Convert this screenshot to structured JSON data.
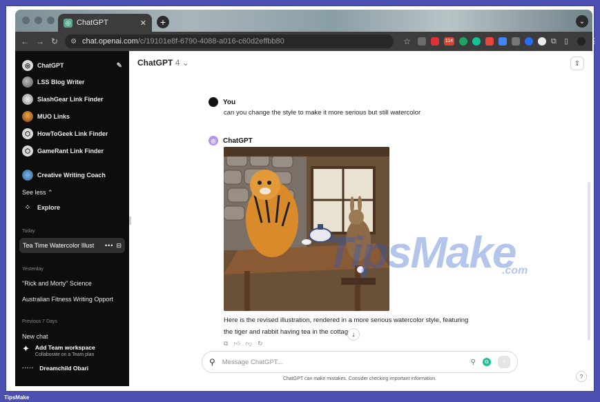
{
  "browser": {
    "tab_title": "ChatGPT",
    "url_host": "chat.openai.com",
    "url_path": "/c/19101e8f-6790-4088-a016-c60d2effbb80",
    "ext_badge": "114"
  },
  "sidebar": {
    "gpts": [
      {
        "label": "ChatGPT"
      },
      {
        "label": "LSS Blog Writer"
      },
      {
        "label": "SlashGear Link Finder"
      },
      {
        "label": "MUO Links"
      },
      {
        "label": "HowToGeek Link Finder"
      },
      {
        "label": "GameRant Link Finder"
      },
      {
        "label": "Creative Writing Coach"
      }
    ],
    "see_less": "See less",
    "explore": "Explore",
    "today": "Today",
    "active_chat": "Tea Time Watercolor Illust",
    "yesterday": "Yesterday",
    "yesterday_items": [
      "\"Rick and Morty\" Science",
      "Australian Fitness Writing Opport"
    ],
    "previous": "Previous 7 Days",
    "new_chat": "New chat",
    "team_title": "Add Team workspace",
    "team_sub": "Collaborate on a Team plan",
    "user_name": "Dreamchild Obari",
    "user_avatar": "•••••"
  },
  "main": {
    "model": "ChatGPT",
    "model_version": "4",
    "you_label": "You",
    "user_message": "can you change the style to make it more serious but still watercolor",
    "gpt_label": "ChatGPT",
    "response_line1": "Here is the revised illustration, rendered in a more serious watercolor style, featuring",
    "response_line2": "the tiger and rabbit having tea in the cottag",
    "composer_placeholder": "Message ChatGPT...",
    "disclaimer": "ChatGPT can make mistakes. Consider checking important information.",
    "help": "?"
  },
  "watermark": {
    "big": "TipsMake",
    "small": ".com"
  },
  "footer": {
    "brand": "TipsMake"
  },
  "colors": {
    "accent": "#4a4fb0",
    "sidebar_bg": "#0d0d0d",
    "gpt_avatar": "#b596e6"
  }
}
